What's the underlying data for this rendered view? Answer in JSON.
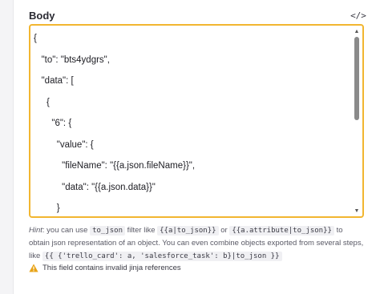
{
  "field": {
    "label": "Body",
    "code_toggle_icon": "code-icon",
    "toggle_glyph": "</>"
  },
  "editor": {
    "lines": [
      "{",
      "   \"to\": \"bts4ydgrs\",",
      "   \"data\": [",
      "     {",
      "       \"6\": {",
      "         \"value\": {",
      "           \"fileName\": \"{{a.json.fileName}}\",",
      "           \"data\": \"{{a.json.data}}\"",
      "         }",
      "       }"
    ],
    "scroll_position": 0.0,
    "border_color": "#f2b630"
  },
  "hint": {
    "prefix": "Hint",
    "t1": ": you can use ",
    "c1": "to_json",
    "t2": " filter like ",
    "c2": "{{a|to_json}}",
    "t3": " or ",
    "c3": "{{a.attribute|to_json}}",
    "t4": " to obtain json representation of an object. You can even combine objects exported from several steps, like ",
    "c4": "{{ {'trello_card': a, 'salesforce_task': b}|to_json }}"
  },
  "warning": {
    "icon": "warning-icon",
    "color": "#e8a317",
    "text": "This field contains invalid jinja references"
  }
}
